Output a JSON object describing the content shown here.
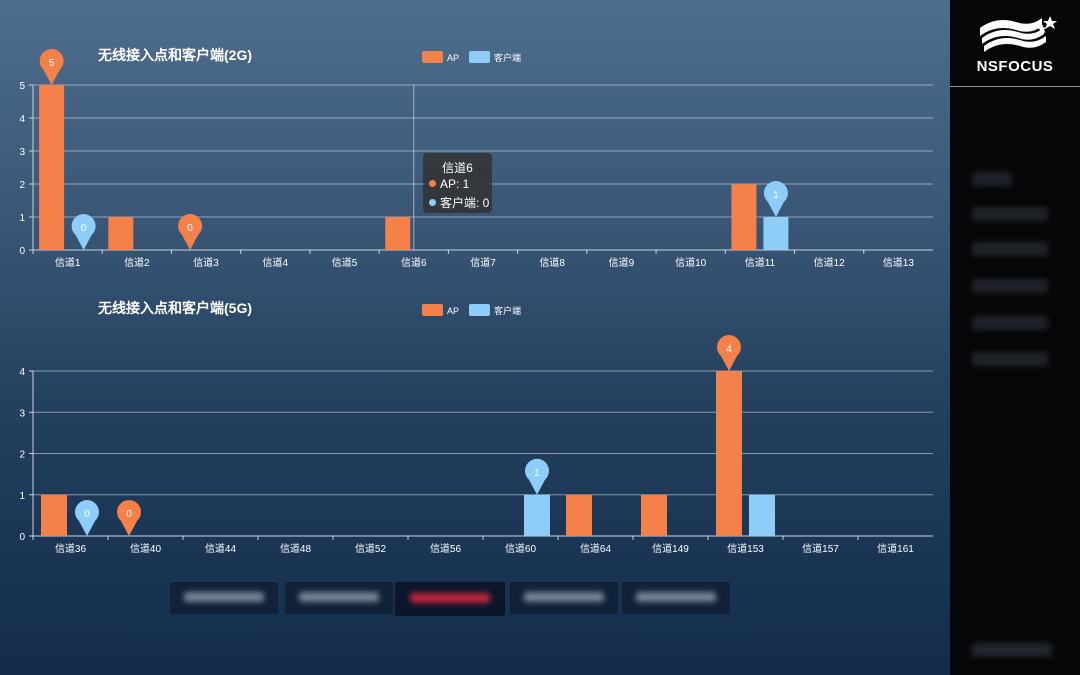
{
  "chart_data": [
    {
      "type": "bar",
      "title": "无线接入点和客户端(2G)",
      "categories": [
        "信道1",
        "信道2",
        "信道3",
        "信道4",
        "信道5",
        "信道6",
        "信道7",
        "信道8",
        "信道9",
        "信道10",
        "信道11",
        "信道12",
        "信道13"
      ],
      "series": [
        {
          "name": "AP",
          "color": "#f4804a",
          "values": [
            5,
            1,
            0,
            0,
            0,
            1,
            0,
            0,
            0,
            0,
            2,
            0,
            0
          ]
        },
        {
          "name": "客户端",
          "color": "#8dcdf8",
          "values": [
            0,
            0,
            0,
            0,
            0,
            0,
            0,
            0,
            0,
            0,
            1,
            0,
            0
          ]
        }
      ],
      "ylim": [
        0,
        5
      ],
      "yticks": [
        "0",
        "1",
        "2",
        "3",
        "4",
        "5"
      ],
      "grid": true,
      "legend_position": "top-center",
      "markers": [
        {
          "series": 0,
          "index": 0,
          "label": "5"
        },
        {
          "series": 1,
          "index": 0,
          "label": "0"
        },
        {
          "series": 0,
          "index": 2,
          "label": "0"
        },
        {
          "series": 1,
          "index": 10,
          "label": "1"
        }
      ],
      "tooltip": {
        "index": 5,
        "title": "信道6",
        "rows": [
          "AP: 1",
          "客户端: 0"
        ]
      }
    },
    {
      "type": "bar",
      "title": "无线接入点和客户端(5G)",
      "categories": [
        "信道36",
        "信道40",
        "信道44",
        "信道48",
        "信道52",
        "信道56",
        "信道60",
        "信道64",
        "信道149",
        "信道153",
        "信道157",
        "信道161"
      ],
      "series": [
        {
          "name": "AP",
          "color": "#f4804a",
          "values": [
            1,
            0,
            0,
            0,
            0,
            0,
            0,
            1,
            1,
            4,
            0,
            0
          ]
        },
        {
          "name": "客户端",
          "color": "#8dcdf8",
          "values": [
            0,
            0,
            0,
            0,
            0,
            0,
            1,
            0,
            0,
            1,
            0,
            0
          ]
        }
      ],
      "ylim": [
        0,
        4
      ],
      "yticks": [
        "0",
        "1",
        "2",
        "3",
        "4"
      ],
      "grid": true,
      "legend_position": "top-center",
      "markers": [
        {
          "series": 1,
          "index": 0,
          "label": "0"
        },
        {
          "series": 0,
          "index": 1,
          "label": "0"
        },
        {
          "series": 1,
          "index": 6,
          "label": "1"
        },
        {
          "series": 0,
          "index": 9,
          "label": "4"
        }
      ]
    }
  ],
  "sidebar": {
    "brand": "NSFOCUS"
  }
}
